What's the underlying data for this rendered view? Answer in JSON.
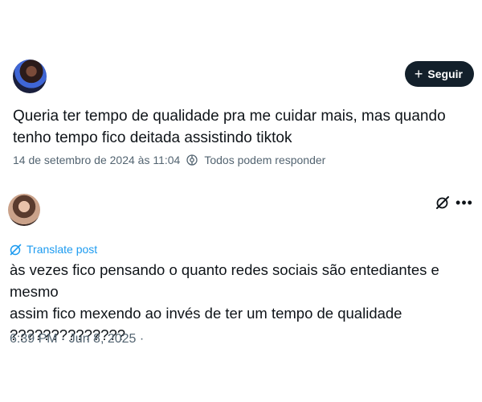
{
  "post1": {
    "follow_label": "Seguir",
    "text": "Queria ter tempo de qualidade pra me cuidar mais, mas quando tenho tempo fico deitada assistindo tiktok",
    "timestamp": "14 de setembro de 2024 às 11:04",
    "reply_setting": "Todos podem responder"
  },
  "post2": {
    "translate_label": "Translate post",
    "text_line1": "às vezes fico pensando o quanto redes sociais são entediantes e mesmo",
    "text_line2": "assim fico mexendo ao invés de ter um tempo de qualidade",
    "text_line3": "??????????????",
    "timestamp": "6:39 PM · Jun 8, 2025 ·"
  },
  "colors": {
    "text": "#0f1419",
    "muted": "#536471",
    "link": "#1d9bf0",
    "button_bg": "#13202b"
  },
  "icons": [
    "reply-settings-icon",
    "grok-icon",
    "more-icon",
    "translate-icon",
    "plus-icon"
  ]
}
